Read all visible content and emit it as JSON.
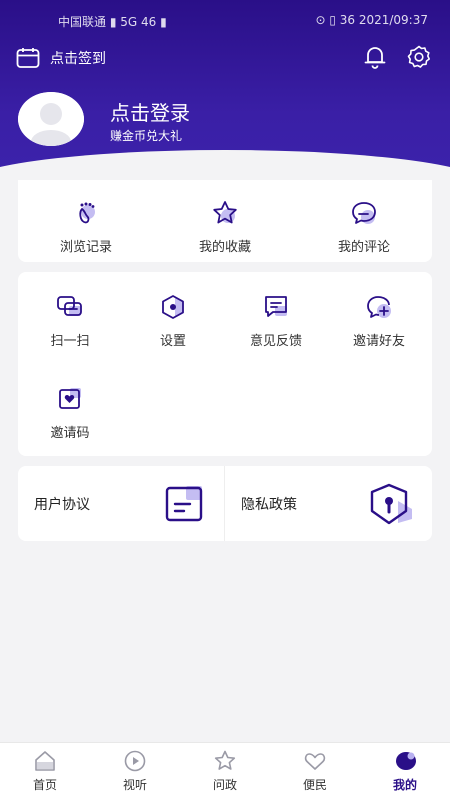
{
  "status_bar": {
    "left": "中国联通 ▮ 5G 46 ▮",
    "right": "⊙ ▯ 36 2021/09:37"
  },
  "header": {
    "sign_in_label": "点击签到",
    "user_name": "点击登录",
    "user_sub": "赚金币兑大礼"
  },
  "quick_actions": [
    {
      "label": "浏览记录",
      "icon": "footprint-icon"
    },
    {
      "label": "我的收藏",
      "icon": "star-icon"
    },
    {
      "label": "我的评论",
      "icon": "comment-icon"
    }
  ],
  "tools": [
    {
      "label": "扫一扫",
      "icon": "scan-icon"
    },
    {
      "label": "设置",
      "icon": "settings-icon"
    },
    {
      "label": "意见反馈",
      "icon": "feedback-icon"
    },
    {
      "label": "邀请好友",
      "icon": "invite-friend-icon"
    },
    {
      "label": "邀请码",
      "icon": "invite-code-icon"
    }
  ],
  "policies": [
    {
      "label": "用户协议",
      "icon": "document-icon"
    },
    {
      "label": "隐私政策",
      "icon": "shield-lock-icon"
    }
  ],
  "tabs": [
    {
      "label": "首页",
      "icon": "home-icon"
    },
    {
      "label": "视听",
      "icon": "play-icon"
    },
    {
      "label": "问政",
      "icon": "star-icon"
    },
    {
      "label": "便民",
      "icon": "heart-icon"
    },
    {
      "label": "我的",
      "icon": "user-icon",
      "active": true
    }
  ],
  "colors": {
    "brand": "#2a0f88",
    "accent": "#b8b0f0",
    "background": "#f3f3f5"
  }
}
